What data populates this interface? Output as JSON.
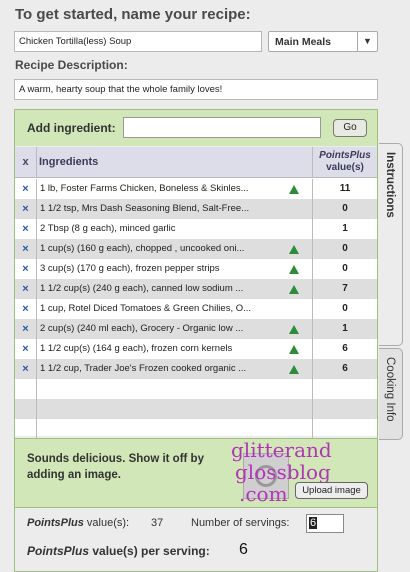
{
  "header": {
    "title": "To get started, name your recipe:",
    "recipe_name": "Chicken Tortilla(less) Soup",
    "category": "Main Meals",
    "desc_label": "Recipe Description:",
    "description": "A warm, hearty soup that the whole family loves!"
  },
  "add": {
    "label": "Add ingredient:",
    "value": "",
    "go_label": "Go"
  },
  "table": {
    "x_header": "x",
    "ingredients_header": "Ingredients",
    "points_header_1": "PointsPlus",
    "points_header_2": "value(s)",
    "remove_symbol": "×",
    "rows": [
      {
        "text": "1 lb, Foster Farms Chicken, Boneless & Skinles...",
        "points": "11",
        "flag": true
      },
      {
        "text": "1 1/2 tsp, Mrs Dash Seasoning Blend, Salt-Free...",
        "points": "0",
        "flag": false
      },
      {
        "text": "2 Tbsp (8 g each), minced garlic",
        "points": "1",
        "flag": false
      },
      {
        "text": "1 cup(s) (160 g each), chopped , uncooked oni...",
        "points": "0",
        "flag": true
      },
      {
        "text": "3 cup(s) (170 g each), frozen pepper strips",
        "points": "0",
        "flag": true
      },
      {
        "text": "1 1/2 cup(s) (240 g each), canned low sodium ...",
        "points": "7",
        "flag": true
      },
      {
        "text": "1 cup, Rotel Diced Tomatoes & Green Chilies, O...",
        "points": "0",
        "flag": false
      },
      {
        "text": "2 cup(s) (240 ml each), Grocery - Organic low ...",
        "points": "1",
        "flag": true
      },
      {
        "text": "1 1/2 cup(s) (164 g each), frozen corn kernels",
        "points": "6",
        "flag": true
      },
      {
        "text": "1 1/2 cup, Trader Joe's Frozen cooked organic ...",
        "points": "6",
        "flag": true
      }
    ]
  },
  "image_area": {
    "prompt": "Sounds delicious. Show it off by adding an image.",
    "upload_label": "Upload image",
    "watermark_lines": [
      "glitterand",
      "glossblog",
      ".com"
    ]
  },
  "summary": {
    "points_label_bold": "PointsPlus",
    "points_label_rest": " value(s):",
    "total": "37",
    "servings_label": "Number of servings:",
    "servings_value": "6",
    "per_label_bold": "PointsPlus",
    "per_label_rest": " value(s) per serving:",
    "per_value": "6"
  },
  "tabs": {
    "instructions": "Instructions",
    "cooking_info": "Cooking Info"
  },
  "colors": {
    "green_bar": "#d2e7b8",
    "remove_x": "#2a58a8",
    "flag_triangle": "#2e8b3a",
    "watermark": "#b235b8"
  }
}
